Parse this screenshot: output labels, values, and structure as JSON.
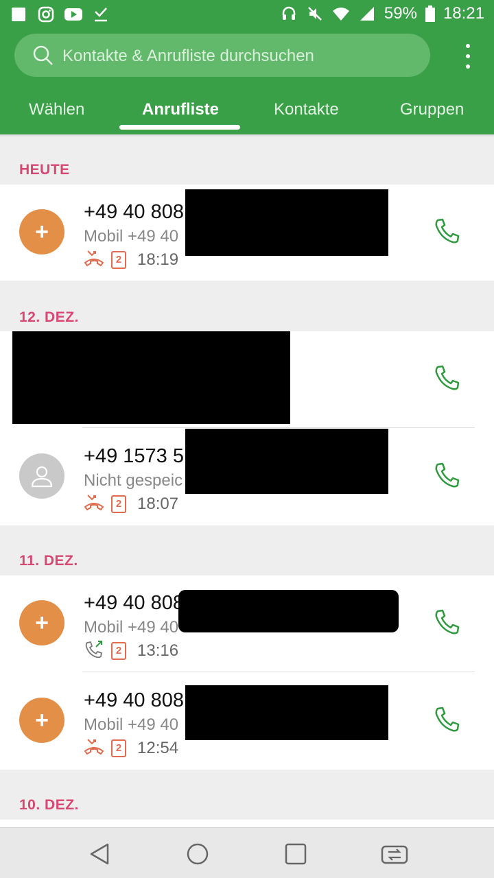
{
  "status_bar": {
    "left_icons": [
      "notification-square-icon",
      "instagram-icon",
      "youtube-icon",
      "download-done-icon"
    ],
    "right_icons": [
      "headset-icon",
      "mute-icon",
      "wifi-icon",
      "signal-icon",
      "battery-icon"
    ],
    "battery": "59%",
    "time": "18:21"
  },
  "search": {
    "placeholder": "Kontakte & Anrufliste durchsuchen"
  },
  "tabs": [
    {
      "label": "Wählen"
    },
    {
      "label": "Anrufliste"
    },
    {
      "label": "Kontakte"
    },
    {
      "label": "Gruppen"
    }
  ],
  "sections": [
    {
      "label": "HEUTE",
      "entries": [
        {
          "number": "+49 40 808",
          "sub": "Mobil +49 40",
          "sim": "2",
          "time": "18:19",
          "type": "missed",
          "avatar": "orange-plus"
        }
      ]
    },
    {
      "label": "12. DEZ.",
      "entries": [
        {
          "number": "",
          "sub": "",
          "sim": "",
          "time": "",
          "type": "redacted",
          "avatar": ""
        },
        {
          "number": "+49 1573 5",
          "sub": "Nicht gespeic",
          "sim": "2",
          "time": "18:07",
          "type": "missed",
          "avatar": "grey-person"
        }
      ]
    },
    {
      "label": "11. DEZ.",
      "entries": [
        {
          "number": "+49 40 808",
          "sub": "Mobil +49 40",
          "sim": "2",
          "time": "13:16",
          "type": "outgoing",
          "avatar": "orange-plus"
        },
        {
          "number": "+49 40 808",
          "sub": "Mobil +49 40",
          "sim": "2",
          "time": "12:54",
          "type": "missed",
          "avatar": "orange-plus"
        }
      ]
    },
    {
      "label": "10. DEZ.",
      "entries": []
    }
  ],
  "colors": {
    "brand_green": "#3aa047",
    "section_pink": "#d84672",
    "missed_red": "#e06b4d",
    "avatar_orange": "#e38f47",
    "call_green": "#2e9a3e"
  }
}
